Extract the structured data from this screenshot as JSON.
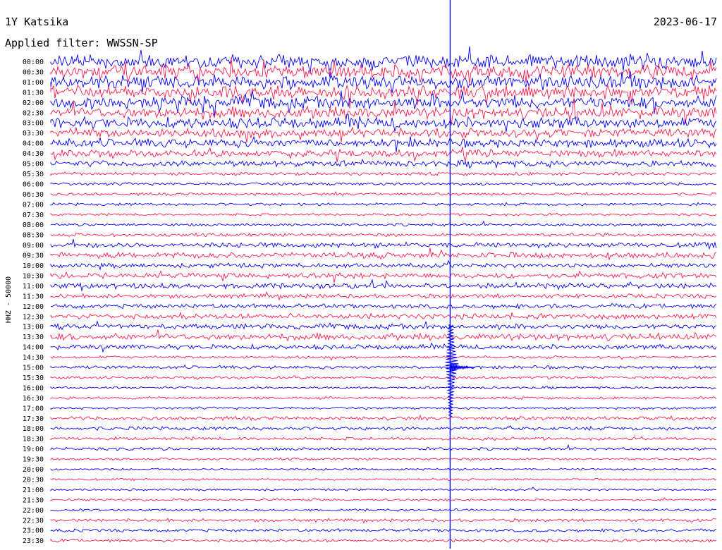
{
  "chart_data": {
    "type": "line",
    "title": "1Y Katsika",
    "date": "2023-06-17",
    "subtitle": "Applied filter: WWSSN-SP",
    "ylabel": "HHZ - 50000",
    "colors": [
      "#0000ff",
      "#ff1a4b"
    ],
    "rows": [
      {
        "label": "00:00",
        "activity": 0.95
      },
      {
        "label": "00:30",
        "activity": 0.95
      },
      {
        "label": "01:00",
        "activity": 0.9
      },
      {
        "label": "01:30",
        "activity": 0.9
      },
      {
        "label": "02:00",
        "activity": 0.85
      },
      {
        "label": "02:30",
        "activity": 0.8
      },
      {
        "label": "03:00",
        "activity": 0.75
      },
      {
        "label": "03:30",
        "activity": 0.6
      },
      {
        "label": "04:00",
        "activity": 0.55
      },
      {
        "label": "04:30",
        "activity": 0.45
      },
      {
        "label": "05:00",
        "activity": 0.35
      },
      {
        "label": "05:30",
        "activity": 0.12
      },
      {
        "label": "06:00",
        "activity": 0.1
      },
      {
        "label": "06:30",
        "activity": 0.08
      },
      {
        "label": "07:00",
        "activity": 0.1
      },
      {
        "label": "07:30",
        "activity": 0.05
      },
      {
        "label": "08:00",
        "activity": 0.08
      },
      {
        "label": "08:30",
        "activity": 0.12
      },
      {
        "label": "09:00",
        "activity": 0.28
      },
      {
        "label": "09:30",
        "activity": 0.35
      },
      {
        "label": "10:00",
        "activity": 0.22
      },
      {
        "label": "10:30",
        "activity": 0.3
      },
      {
        "label": "11:00",
        "activity": 0.3
      },
      {
        "label": "11:30",
        "activity": 0.2
      },
      {
        "label": "12:00",
        "activity": 0.22
      },
      {
        "label": "12:30",
        "activity": 0.3
      },
      {
        "label": "13:00",
        "activity": 0.28
      },
      {
        "label": "13:30",
        "activity": 0.4
      },
      {
        "label": "14:00",
        "activity": 0.25
      },
      {
        "label": "14:30",
        "activity": 0.08
      },
      {
        "label": "15:00",
        "activity": 0.12
      },
      {
        "label": "15:30",
        "activity": 0.08
      },
      {
        "label": "16:00",
        "activity": 0.06
      },
      {
        "label": "16:30",
        "activity": 0.06
      },
      {
        "label": "17:00",
        "activity": 0.06
      },
      {
        "label": "17:30",
        "activity": 0.15
      },
      {
        "label": "18:00",
        "activity": 0.15
      },
      {
        "label": "18:30",
        "activity": 0.12
      },
      {
        "label": "19:00",
        "activity": 0.1
      },
      {
        "label": "19:30",
        "activity": 0.04
      },
      {
        "label": "20:00",
        "activity": 0.03
      },
      {
        "label": "20:30",
        "activity": 0.03
      },
      {
        "label": "21:00",
        "activity": 0.03
      },
      {
        "label": "21:30",
        "activity": 0.04
      },
      {
        "label": "22:00",
        "activity": 0.05
      },
      {
        "label": "22:30",
        "activity": 0.12
      },
      {
        "label": "23:00",
        "activity": 0.1
      },
      {
        "label": "23:30",
        "activity": 0.1
      }
    ],
    "event": {
      "time": "15:00",
      "offset_fraction": 0.6
    }
  }
}
